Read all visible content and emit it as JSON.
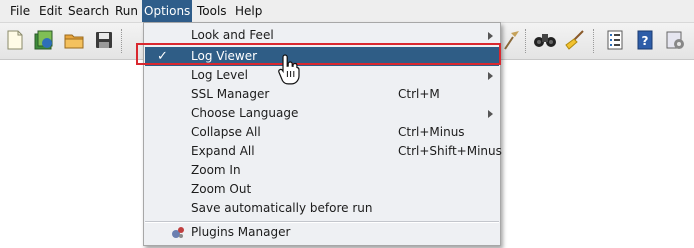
{
  "menubar": {
    "items": [
      {
        "label": "File"
      },
      {
        "label": "Edit"
      },
      {
        "label": "Search"
      },
      {
        "label": "Run"
      },
      {
        "label": "Options"
      },
      {
        "label": "Tools"
      },
      {
        "label": "Help"
      }
    ],
    "active_color": "#2f5d8a"
  },
  "toolbar": {
    "icons": [
      "new-file-icon",
      "open-templates-icon",
      "open-folder-icon",
      "save-icon",
      "tool-icon",
      "binoculars-icon",
      "broom-icon",
      "list-icon",
      "help-book-icon",
      "settings-icon"
    ]
  },
  "options_menu": {
    "items": [
      {
        "label": "Look and Feel",
        "accelerator": "",
        "submenu": true,
        "checked": false
      },
      {
        "label": "Log Viewer",
        "accelerator": "",
        "submenu": false,
        "checked": true,
        "check_mark": "✓"
      },
      {
        "label": "Log Level",
        "accelerator": "",
        "submenu": true,
        "checked": false
      },
      {
        "label": "SSL Manager",
        "accelerator": "Ctrl+M",
        "submenu": false,
        "checked": false
      },
      {
        "label": "Choose Language",
        "accelerator": "",
        "submenu": true,
        "checked": false
      },
      {
        "label": "Collapse All",
        "accelerator": "Ctrl+Minus",
        "submenu": false,
        "checked": false
      },
      {
        "label": "Expand All",
        "accelerator": "Ctrl+Shift+Minus",
        "submenu": false,
        "checked": false
      },
      {
        "label": "Zoom In",
        "accelerator": "",
        "submenu": false,
        "checked": false
      },
      {
        "label": "Zoom Out",
        "accelerator": "",
        "submenu": false,
        "checked": false
      },
      {
        "label": "Save automatically before run",
        "accelerator": "",
        "submenu": false,
        "checked": false
      }
    ],
    "plugins": {
      "label": "Plugins Manager",
      "icon": "plugins-icon"
    },
    "selected_color": "#2f5d86",
    "highlight_color": "#d9282f"
  }
}
